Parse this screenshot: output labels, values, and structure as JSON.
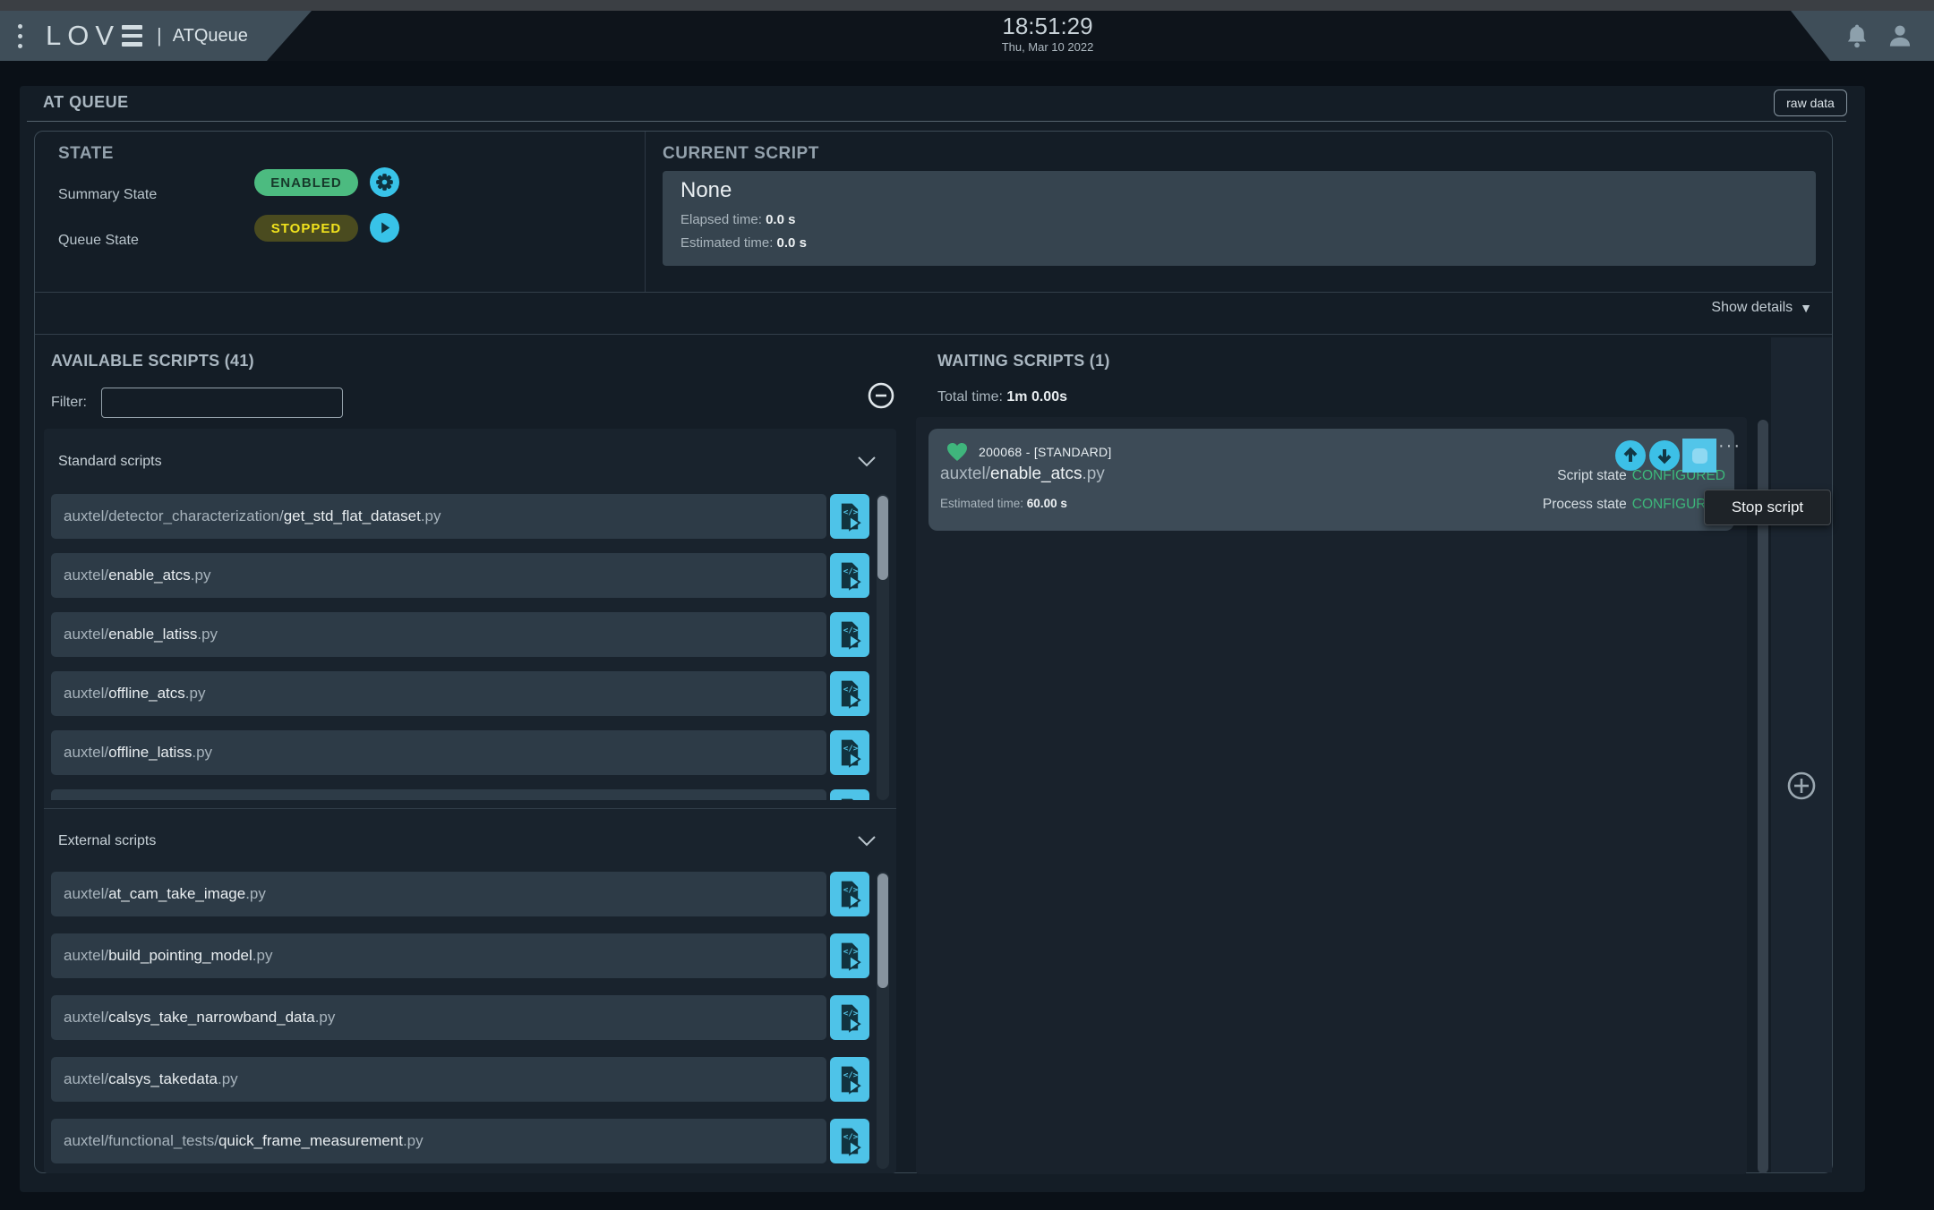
{
  "topbar": {
    "logo_word": "LOV",
    "app_name": "ATQueue",
    "time": "18:51:29",
    "date": "Thu, Mar 10 2022"
  },
  "header": {
    "title": "AT QUEUE",
    "raw_data_label": "raw data"
  },
  "state": {
    "heading": "STATE",
    "summary_label": "Summary State",
    "summary_value": "ENABLED",
    "queue_label": "Queue State",
    "queue_value": "STOPPED"
  },
  "current_script": {
    "heading": "CURRENT SCRIPT",
    "name": "None",
    "elapsed_label": "Elapsed time:",
    "elapsed_value": "0.0 s",
    "estimated_label": "Estimated time:",
    "estimated_value": "0.0 s"
  },
  "details": {
    "show_details_label": "Show details",
    "chevron": "▼"
  },
  "available": {
    "heading": "AVAILABLE SCRIPTS (41)",
    "filter_label": "Filter:",
    "filter_value": "",
    "standard_label": "Standard scripts",
    "external_label": "External scripts",
    "standard_scripts": [
      {
        "prefix": "auxtel/detector_characterization/",
        "name": "get_std_flat_dataset",
        "ext": ".py"
      },
      {
        "prefix": "auxtel/",
        "name": "enable_atcs",
        "ext": ".py"
      },
      {
        "prefix": "auxtel/",
        "name": "enable_latiss",
        "ext": ".py"
      },
      {
        "prefix": "auxtel/",
        "name": "offline_atcs",
        "ext": ".py"
      },
      {
        "prefix": "auxtel/",
        "name": "offline_latiss",
        "ext": ".py"
      },
      {
        "prefix": "",
        "name": "",
        "ext": ""
      }
    ],
    "external_scripts": [
      {
        "prefix": "auxtel/",
        "name": "at_cam_take_image",
        "ext": ".py"
      },
      {
        "prefix": "auxtel/",
        "name": "build_pointing_model",
        "ext": ".py"
      },
      {
        "prefix": "auxtel/",
        "name": "calsys_take_narrowband_data",
        "ext": ".py"
      },
      {
        "prefix": "auxtel/",
        "name": "calsys_takedata",
        "ext": ".py"
      },
      {
        "prefix": "auxtel/functional_tests/",
        "name": "quick_frame_measurement",
        "ext": ".py"
      }
    ]
  },
  "waiting": {
    "heading": "WAITING SCRIPTS (1)",
    "total_label": "Total time:",
    "total_value": "1m 0.00s",
    "script": {
      "id": "200068 - [STANDARD]",
      "prefix": "auxtel/",
      "name": "enable_atcs",
      "ext": ".py",
      "estimated_label": "Estimated time:",
      "estimated_value": "60.00 s",
      "script_state_label": "Script state",
      "script_state": "CONFIGURED",
      "process_state_label": "Process state",
      "process_state": "CONFIGURED",
      "more": "···"
    },
    "tooltip": "Stop script"
  },
  "colors": {
    "accent_cyan": "#38c3e8",
    "state_enabled_bg": "#4cbb80",
    "state_stopped_bg": "#4a4b1f",
    "state_stopped_text": "#f1e31d",
    "configured_green": "#3db87b",
    "heart_green": "#3fb57c"
  }
}
